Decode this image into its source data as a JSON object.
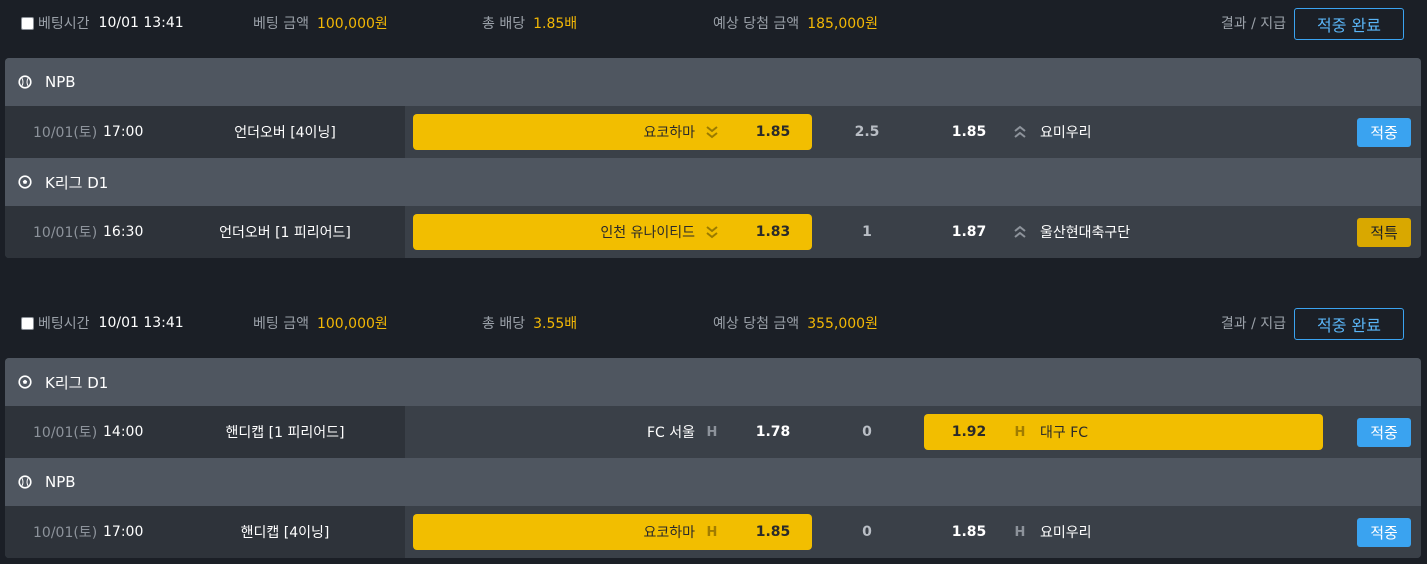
{
  "slips": [
    {
      "bet_time_label": "베팅시간",
      "bet_time": "10/01 13:41",
      "bet_amount_label": "베팅 금액",
      "bet_amount": "100,000원",
      "total_odds_label": "총 배당",
      "total_odds": "1.85배",
      "expected_label": "예상 당첨 금액",
      "expected": "185,000원",
      "result_label": "결과 / 지급",
      "done_label": "적중 완료",
      "matches": [
        {
          "league": "NPB",
          "league_icon": "baseball-icon",
          "date": "10/01(토)",
          "time": "17:00",
          "bet_type": "언더오버 [4이닝]",
          "home_team": "요코하마",
          "home_indicator": "under-arrows-icon",
          "home_odds": "1.85",
          "handicap": "2.5",
          "away_odds": "1.85",
          "away_indicator": "over-arrows-icon",
          "away_team": "요미우리",
          "selected": "home",
          "status": "적중",
          "status_kind": "win"
        },
        {
          "league": "K리그 D1",
          "league_icon": "soccer-ball-icon",
          "date": "10/01(토)",
          "time": "16:30",
          "bet_type": "언더오버 [1 피리어드]",
          "home_team": "인천 유나이티드",
          "home_indicator": "under-arrows-icon",
          "home_odds": "1.83",
          "handicap": "1",
          "away_odds": "1.87",
          "away_indicator": "over-arrows-icon",
          "away_team": "울산현대축구단",
          "selected": "home",
          "status": "적특",
          "status_kind": "special"
        }
      ]
    },
    {
      "bet_time_label": "베팅시간",
      "bet_time": "10/01 13:41",
      "bet_amount_label": "베팅 금액",
      "bet_amount": "100,000원",
      "total_odds_label": "총 배당",
      "total_odds": "3.55배",
      "expected_label": "예상 당첨 금액",
      "expected": "355,000원",
      "result_label": "결과 / 지급",
      "done_label": "적중 완료",
      "matches": [
        {
          "league": "K리그 D1",
          "league_icon": "soccer-ball-icon",
          "date": "10/01(토)",
          "time": "14:00",
          "bet_type": "핸디캡 [1 피리어드]",
          "home_team": "FC 서울",
          "home_indicator": "H",
          "home_odds": "1.78",
          "handicap": "0",
          "away_odds": "1.92",
          "away_indicator": "H",
          "away_team": "대구 FC",
          "selected": "away",
          "status": "적중",
          "status_kind": "win"
        },
        {
          "league": "NPB",
          "league_icon": "baseball-icon",
          "date": "10/01(토)",
          "time": "17:00",
          "bet_type": "핸디캡 [4이닝]",
          "home_team": "요코하마",
          "home_indicator": "H",
          "home_odds": "1.85",
          "handicap": "0",
          "away_odds": "1.85",
          "away_indicator": "H",
          "away_team": "요미우리",
          "selected": "home",
          "status": "적중",
          "status_kind": "win"
        }
      ]
    }
  ],
  "colors": {
    "accent_gold": "#f2be00",
    "win_blue": "#3aa3f0",
    "special_gold": "#d9a800"
  }
}
